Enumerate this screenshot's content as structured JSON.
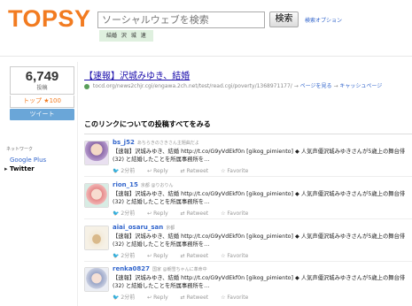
{
  "header": {
    "logo": "TOPSY",
    "search_placeholder": "ソーシャルウェブを検索",
    "search_button": "検索",
    "search_options": "検索オプション",
    "filters": "結婚 沢 城 速"
  },
  "stats": {
    "count": "6,749",
    "count_label": "投稿",
    "top_badge": "トップ ★100",
    "tweet_button": "ツイート"
  },
  "sidebar": {
    "network_label": "ネットワーク",
    "items": [
      "Google Plus",
      "Twitter"
    ]
  },
  "article": {
    "headline": "【速報】沢城みゆき、結婚",
    "url": "tocd.org/news2chjr.cgi/engawa.2ch.net/test/read.cgi/poverty/1368971177/",
    "link_trackback": "ページを見る",
    "link_cache": "キャッシュページ",
    "section_heading": "このリンクについての投稿すべてをみる"
  },
  "posts": [
    {
      "user": "bs_j52",
      "meta": "あちらきのさきさん主題曲だよ",
      "text1": "【速報】沢城みゆき、結婚 http://t.co/G9yVdEkf0n [gikog_pimiento] ◆ 人気声優沢城みゆきさんが5歳上の舞台俳",
      "text2": "(32) と結婚したことを所属事務所を…",
      "time": "2分前",
      "reply": "Reply",
      "retweet": "Retweet",
      "favorite": "Favorite"
    },
    {
      "user": "rion_15",
      "meta": "京都 @りおりん",
      "text1": "【速報】沢城みゆき、結婚 http://t.co/G9yVdEkf0n [gikog_pimiento] ◆ 人気声優沢城みゆきさんが5歳上の舞台俳",
      "text2": "(32) と結婚したことを所属事務所を…",
      "time": "2分前",
      "reply": "Reply",
      "retweet": "Retweet",
      "favorite": "Favorite"
    },
    {
      "user": "aiai_osaru_san",
      "meta": "京都",
      "text1": "【速報】沢城みゆき、結婚 http://t.co/G9yVdEkf0n [gikog_pimiento] ◆ 人気声優沢城みゆきさんが5歳上の舞台俳",
      "text2": "(32) と結婚したことを所属事務所を…",
      "time": "2分前",
      "reply": "Reply",
      "retweet": "Retweet",
      "favorite": "Favorite"
    },
    {
      "user": "renka0827",
      "meta": "国家 @朝雪ちゃんに革命中",
      "text1": "【速報】沢城みゆき、結婚 http://t.co/G9yVdEkf0n [gikog_pimiento] ◆ 人気声優沢城みゆきさんが5歳上の舞台俳",
      "text2": "(32) と結婚したことを所属事務所を…",
      "time": "2分前",
      "reply": "Reply",
      "retweet": "Retweet",
      "favorite": "Favorite"
    }
  ],
  "colors": {
    "brand": "#f27b20",
    "link": "#3366cc",
    "tweet_button": "#6aa6d8"
  }
}
